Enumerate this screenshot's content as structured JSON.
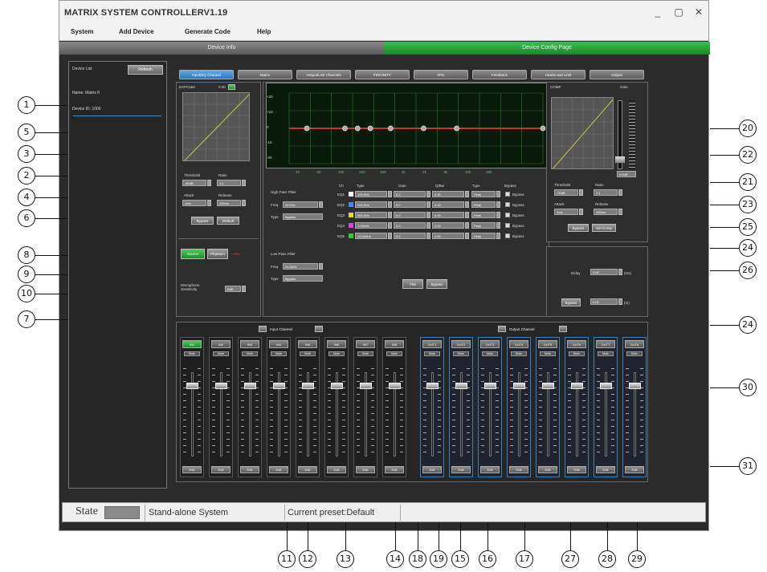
{
  "window": {
    "title": "MATRIX SYSTEM CONTROLLERV1.19",
    "controls": {
      "minimize": "_",
      "maximize": "▢",
      "close": "✕"
    }
  },
  "menu": [
    "System",
    "Add Device",
    "Generate Code",
    "Help"
  ],
  "page_tabs": {
    "info": "Device Info",
    "config": "Device Config Page"
  },
  "device_list": {
    "title": "Device List",
    "refresh": "Refresh",
    "name": "Name: Matrix 8",
    "id": "Device ID: 1000"
  },
  "dsp_tabs": [
    "Input/EQ Channel",
    "Matrix",
    "Output/Link Channels",
    "FIR/UNITY",
    "XFIL",
    "Feedback",
    "Hearts and Limit",
    "Output"
  ],
  "input_panel": {
    "graph_title": "EXP/Gate",
    "graph_value": "0.00",
    "threshold_label": "Threshold",
    "ratio_label": "Ratio",
    "attack_label": "Attack",
    "release_label": "Release",
    "threshold_val": "-80dB",
    "ratio_val": "1:1",
    "attack_val": "1ms",
    "release_val": "100ms",
    "bypass": "Bypass",
    "default": "Default",
    "source_mic": "Source",
    "phantom": "Phantom",
    "db_value": "+48V",
    "mic_sens_label": "Microphone Sensitivity",
    "mic_sens_val": "0dB"
  },
  "peq": {
    "y_ticks": [
      "+20",
      "+10",
      "0",
      "-10",
      "-20"
    ],
    "x_ticks": [
      "20",
      "50",
      "100",
      "200",
      "500",
      "1k",
      "2k",
      "5k",
      "10k",
      "20k",
      "",
      ""
    ],
    "hpf_title": "High Pass Filter",
    "lpf_title": "Low Pass Filter",
    "freq_label": "Freq",
    "type_label": "Type",
    "hpf_freq": "20.0Hz",
    "hpf_type": "Bypass",
    "lpf_freq": "20.0kHz",
    "lpf_type": "Bypass",
    "headers": [
      "Ch",
      "Type",
      "Gain",
      "Q/Bw",
      "Type",
      "Bypass"
    ],
    "bands": [
      {
        "id": "EQ1",
        "freq": "100.0Hz",
        "gain": "0.0",
        "q": "4.00",
        "type": "Peak",
        "color": "#ffffff"
      },
      {
        "id": "EQ2",
        "freq": "200.0Hz",
        "gain": "0.0",
        "q": "4.00",
        "type": "Peak",
        "color": "#3c8cff"
      },
      {
        "id": "EQ3",
        "freq": "500.0Hz",
        "gain": "0.0",
        "q": "4.00",
        "type": "Peak",
        "color": "#dddd33"
      },
      {
        "id": "EQ4",
        "freq": "1.00kHz",
        "gain": "0.0",
        "q": "4.00",
        "type": "Peak",
        "color": "#dd44dd"
      },
      {
        "id": "EQ5",
        "freq": "10.00kHz",
        "gain": "0.0",
        "q": "4.00",
        "type": "Peak",
        "color": "#33cc33"
      }
    ],
    "bypass_label": "Bypass",
    "flat": "Flat",
    "bypass_all": "Bypass"
  },
  "comp_panel": {
    "title": "COMP",
    "gain_title": "Gain",
    "threshold_label": "Threshold",
    "ratio_label": "Ratio",
    "attack_label": "Attack",
    "release_label": "Release",
    "threshold_val": "-20dB",
    "ratio_val": "1:1",
    "attack_val": "1ms",
    "release_val": "100ms",
    "bypass": "Bypass",
    "set_comp": "Set Comp",
    "gain_val": "0.0dB"
  },
  "delay_panel": {
    "delay_label": "Delay",
    "delay_val": "0.00",
    "unit1": "(ms)",
    "bypass": "Bypass",
    "delay_val2": "0.00",
    "unit2": "(m)"
  },
  "mixer": {
    "input_label": "Input Channel",
    "output_label": "Output Channel",
    "inputs": [
      "IN1",
      "IN2",
      "IN3",
      "IN4",
      "IN5",
      "IN6",
      "IN7",
      "IN8"
    ],
    "outputs": [
      "OUT1",
      "OUT2",
      "OUT3",
      "OUT4",
      "OUT5",
      "OUT6",
      "OUT7",
      "OUT8"
    ],
    "mute": "Mute",
    "edit": "Edit"
  },
  "status": {
    "state": "State",
    "mode": "Stand-alone System",
    "preset": "Current preset:Default"
  },
  "callouts": [
    "1",
    "5",
    "3",
    "2",
    "4",
    "6",
    "8",
    "9",
    "10",
    "7",
    "20",
    "22",
    "21",
    "23",
    "25",
    "24",
    "26",
    "24",
    "30",
    "31",
    "11",
    "12",
    "13",
    "14",
    "18",
    "19",
    "15",
    "16",
    "17",
    "27",
    "28",
    "29"
  ]
}
